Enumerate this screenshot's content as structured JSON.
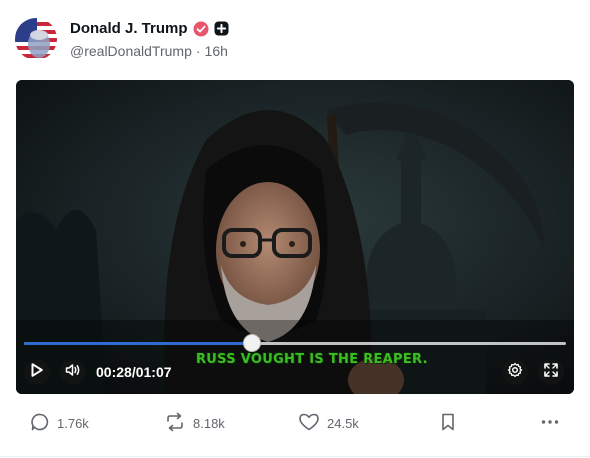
{
  "post": {
    "display_name": "Donald J. Trump",
    "handle": "@realDonaldTrump",
    "separator": "·",
    "time_ago": "16h",
    "icons": {
      "verified": "verified-badge-icon",
      "plus": "plus-badge-icon"
    }
  },
  "video": {
    "current_time": "00:28",
    "time_divider": "/",
    "duration": "01:07",
    "progress_fraction": 0.42,
    "caption": "RUSS VOUGHT IS THE REAPER.",
    "accent_color": "#2f6bd1",
    "caption_color": "#3dbd24"
  },
  "actions": {
    "replies": "1.76k",
    "reposts": "8.18k",
    "likes": "24.5k"
  },
  "colors": {
    "verified": "#e8566b",
    "muted_text": "#62666d"
  }
}
